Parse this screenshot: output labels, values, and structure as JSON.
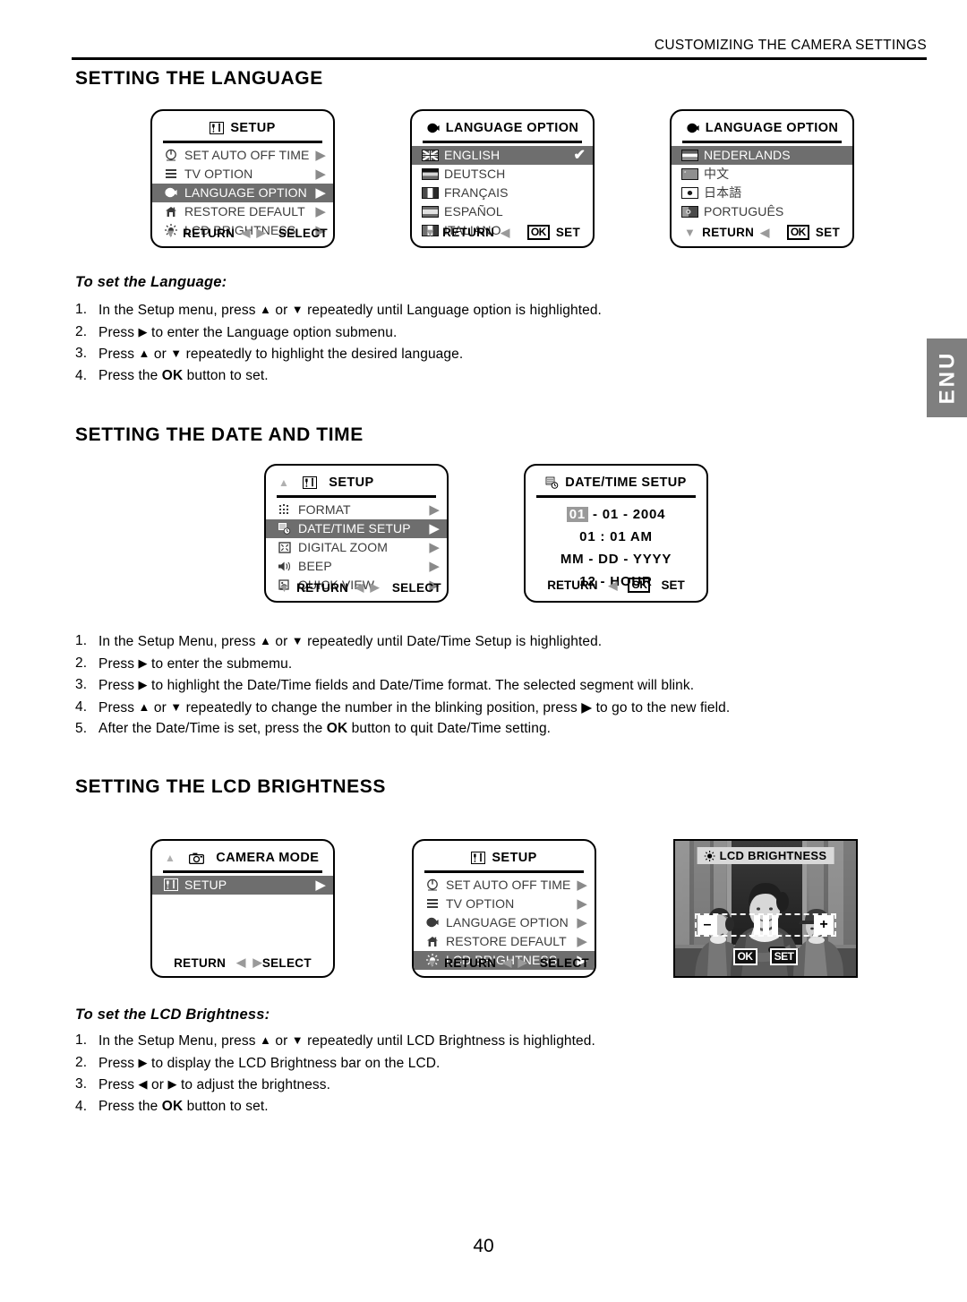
{
  "header": {
    "running_head": "CUSTOMIZING THE CAMERA SETTINGS"
  },
  "side_tab": {
    "label": "ENU"
  },
  "page_number": "40",
  "sections": {
    "language": {
      "title": "SETTING THE LANGUAGE",
      "sub_head": "To set the Language:",
      "steps": [
        {
          "num": "1.",
          "a": "In the Setup menu, press ",
          "t1": "▲",
          "b": " or ",
          "t2": "▼",
          "c": " repeatedly until Language option is highlighted."
        },
        {
          "num": "2.",
          "a": "Press ",
          "t1": "▶",
          "b": " to enter the Language option submenu.",
          "t2": "",
          "c": ""
        },
        {
          "num": "3.",
          "a": "Press ",
          "t1": "▲",
          "b": " or ",
          "t2": "▼",
          "c": " repeatedly to highlight the desired language."
        },
        {
          "num": "4.",
          "a": "Press the ",
          "t1": "",
          "b": "OK",
          "t2": "",
          "c": " button to set."
        }
      ]
    },
    "datetime": {
      "title": "SETTING THE DATE AND TIME",
      "steps": [
        {
          "num": "1.",
          "a": "In the Setup Menu, press ",
          "t1": "▲",
          "b": " or ",
          "t2": "▼",
          "c": " repeatedly until Date/Time Setup is highlighted."
        },
        {
          "num": "2.",
          "a": "Press ",
          "t1": "▶",
          "b": " to enter the submemu.",
          "t2": "",
          "c": ""
        },
        {
          "num": "3.",
          "a": "Press ",
          "t1": "▶",
          "b": " to highlight the Date/Time fields and Date/Time format. The selected segment will blink.",
          "t2": "",
          "c": ""
        },
        {
          "num": "4.",
          "a": "Press ",
          "t1": "▲",
          "b": " or ",
          "t2": "▼",
          "c": " repeatedly to change the number in the blinking position, press ▶ to go to the new field."
        },
        {
          "num": "5.",
          "a": "After the Date/Time is set, press the ",
          "t1": "",
          "b": "OK",
          "t2": "",
          "c": " button to quit Date/Time setting."
        }
      ]
    },
    "lcd_brightness": {
      "title": "SETTING THE LCD BRIGHTNESS",
      "sub_head": "To set the LCD Brightness:",
      "steps": [
        {
          "num": "1.",
          "a": "In the Setup Menu, press ",
          "t1": "▲",
          "b": " or ",
          "t2": "▼",
          "c": " repeatedly until LCD Brightness is highlighted."
        },
        {
          "num": "2.",
          "a": "Press ",
          "t1": "▶",
          "b": " to display the LCD Brightness bar on the LCD.",
          "t2": "",
          "c": ""
        },
        {
          "num": "3.",
          "a": "Press ",
          "t1": "◀",
          "b": " or ",
          "t2": "▶",
          "c": " to adjust the brightness."
        },
        {
          "num": "4.",
          "a": "Press the ",
          "t1": "",
          "b": "OK",
          "t2": "",
          "c": " button to set."
        }
      ]
    }
  },
  "screens": {
    "setup_menu_language": {
      "title": "SETUP",
      "title_icon": "setup-tools-icon",
      "items": [
        {
          "icon": "power-clock-icon",
          "label": "SET AUTO OFF TIME",
          "arrow": "▶",
          "selected": false
        },
        {
          "icon": "tv-lines-icon",
          "label": "TV OPTION",
          "arrow": "▶",
          "selected": false
        },
        {
          "icon": "speech-globe-icon",
          "label": "LANGUAGE OPTION",
          "arrow": "▶",
          "selected": true
        },
        {
          "icon": "house-icon",
          "label": "RESTORE DEFAULT",
          "arrow": "▶",
          "selected": false
        },
        {
          "icon": "sun-icon",
          "label": "LCD BRIGHTNESS",
          "arrow": "▶",
          "selected": false
        }
      ],
      "footer": {
        "down": "▼",
        "return": "RETURN",
        "left": "◀",
        "right": "▶",
        "select": "SELECT"
      }
    },
    "language_page1": {
      "title": "LANGUAGE  OPTION",
      "title_icon": "speech-globe-icon",
      "items": [
        {
          "flag": "uk",
          "label": "ENGLISH",
          "check": "✔",
          "selected": true
        },
        {
          "flag": "germany",
          "label": "DEUTSCH",
          "check": "",
          "selected": false
        },
        {
          "flag": "france",
          "label": "FRANÇAIS",
          "check": "",
          "selected": false
        },
        {
          "flag": "spain",
          "label": "ESPAÑOL",
          "check": "",
          "selected": false
        },
        {
          "flag": "italy",
          "label": "ITALIANO",
          "check": "",
          "selected": false
        }
      ],
      "footer": {
        "down": "▼",
        "return": "RETURN",
        "left": "◀",
        "ok": "OK",
        "set": "SET"
      }
    },
    "language_page2": {
      "title": "LANGUAGE  OPTION",
      "title_icon": "speech-globe-icon",
      "items": [
        {
          "flag": "netherlands",
          "label": "NEDERLANDS",
          "selected": true
        },
        {
          "flag": "china",
          "label": "中文",
          "selected": false
        },
        {
          "flag": "japan",
          "label": "日本語",
          "selected": false
        },
        {
          "flag": "portugal",
          "label": "PORTUGUÊS",
          "selected": false
        }
      ],
      "footer": {
        "down": "▼",
        "return": "RETURN",
        "left": "◀",
        "ok": "OK",
        "set": "SET"
      }
    },
    "setup_menu_datetime": {
      "title": "SETUP",
      "title_icon": "setup-tools-icon",
      "up_arrow": "▲",
      "items": [
        {
          "icon": "format-dots-icon",
          "label": "FORMAT",
          "arrow": "▶",
          "selected": false
        },
        {
          "icon": "date-clock-icon",
          "label": "DATE/TIME SETUP",
          "arrow": "▶",
          "selected": true
        },
        {
          "icon": "digital-zoom-icon",
          "label": "DIGITAL ZOOM",
          "arrow": "▶",
          "selected": false
        },
        {
          "icon": "speaker-icon",
          "label": "BEEP",
          "arrow": "▶",
          "selected": false
        },
        {
          "icon": "quick-view-icon",
          "label": "QUICK VIEW",
          "arrow": "▶",
          "selected": false
        }
      ],
      "footer": {
        "down": "▼",
        "return": "RETURN",
        "left": "◀",
        "right": "▶",
        "select": "SELECT"
      }
    },
    "datetime_setup": {
      "title": "DATE/TIME SETUP",
      "title_icon": "date-clock-icon",
      "date_month": "01",
      "date_rest": " - 01 - 2004",
      "time": "01 : 01 AM",
      "date_format": "MM - DD - YYYY",
      "time_format": "12 - HOUR",
      "footer": {
        "return": "RETURN",
        "left": "◀",
        "ok": "OK",
        "set": "SET"
      }
    },
    "camera_mode": {
      "title": "CAMERA MODE",
      "title_icon": "camera-icon",
      "up_arrow": "▲",
      "items": [
        {
          "icon": "setup-tools-icon",
          "label": "SETUP",
          "arrow": "▶",
          "selected": true
        }
      ],
      "footer": {
        "return": "RETURN",
        "left": "◀",
        "right": "▶",
        "select": "SELECT"
      }
    },
    "setup_menu_brightness": {
      "title": "SETUP",
      "title_icon": "setup-tools-icon",
      "items": [
        {
          "icon": "power-clock-icon",
          "label": "SET AUTO OFF TIME",
          "arrow": "▶",
          "selected": false
        },
        {
          "icon": "tv-lines-icon",
          "label": "TV OPTION",
          "arrow": "▶",
          "selected": false
        },
        {
          "icon": "speech-globe-icon",
          "label": "LANGUAGE OPTION",
          "arrow": "▶",
          "selected": false
        },
        {
          "icon": "house-icon",
          "label": "RESTORE DEFAULT",
          "arrow": "▶",
          "selected": false
        },
        {
          "icon": "sun-icon",
          "label": "LCD BRIGHTNESS",
          "arrow": "▶",
          "selected": true
        }
      ],
      "footer": {
        "down": "▼",
        "return": "RETURN",
        "left": "◀",
        "right": "▶",
        "select": "SELECT"
      }
    },
    "brightness_preview": {
      "title": "LCD BRIGHTNESS",
      "title_icon": "sun-icon",
      "minus": "–",
      "plus": "+",
      "ok": "OK",
      "set": "SET"
    }
  }
}
